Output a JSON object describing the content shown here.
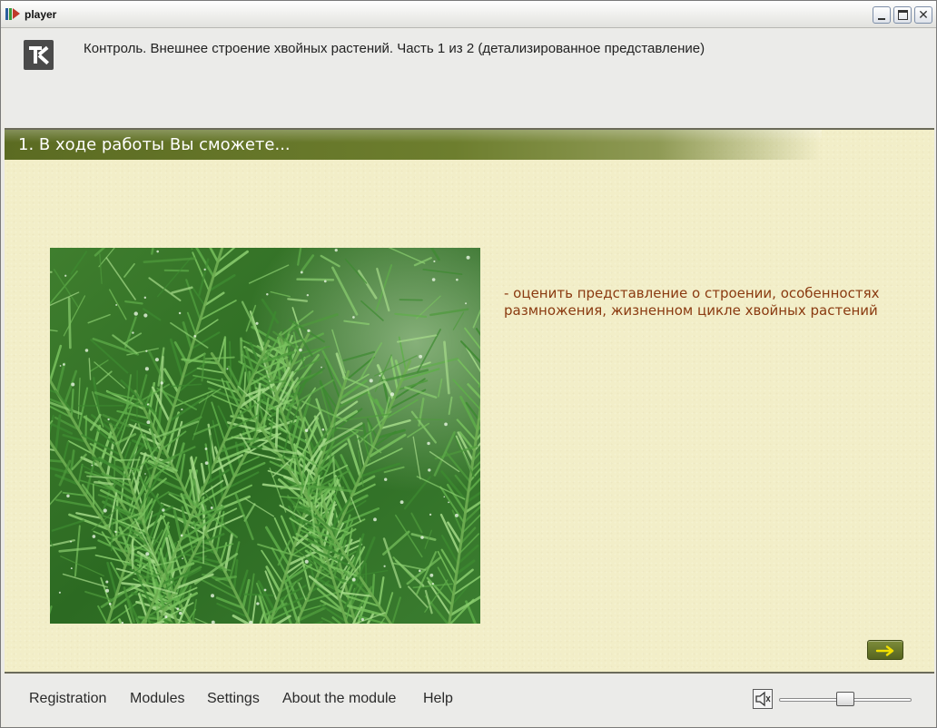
{
  "window": {
    "title": "player"
  },
  "header": {
    "logo_icon": "tk-logo",
    "title": "Контроль. Внешнее строение хвойных растений. Часть 1 из 2 (детализированное представление)"
  },
  "section": {
    "title": "1. В ходе работы Вы сможете...",
    "image_subject": "conifer-needles-photo",
    "bullet": "- оценить представление о строении, особенностях размножения, жизненном цикле хвойных растений",
    "next_icon": "arrow-right-icon"
  },
  "footer": {
    "menu": [
      {
        "label": "Registration"
      },
      {
        "label": "Modules"
      },
      {
        "label": "Settings"
      },
      {
        "label": "About the module"
      },
      {
        "label": "Help"
      }
    ],
    "sound_icon": "speaker-icon",
    "volume": 0.5
  },
  "colors": {
    "banner": "#5b6b22",
    "content_bg": "#f2eec8",
    "bullet_text": "#8a3a10",
    "next_button": "#6b7a2c",
    "next_arrow": "#f2e000"
  }
}
